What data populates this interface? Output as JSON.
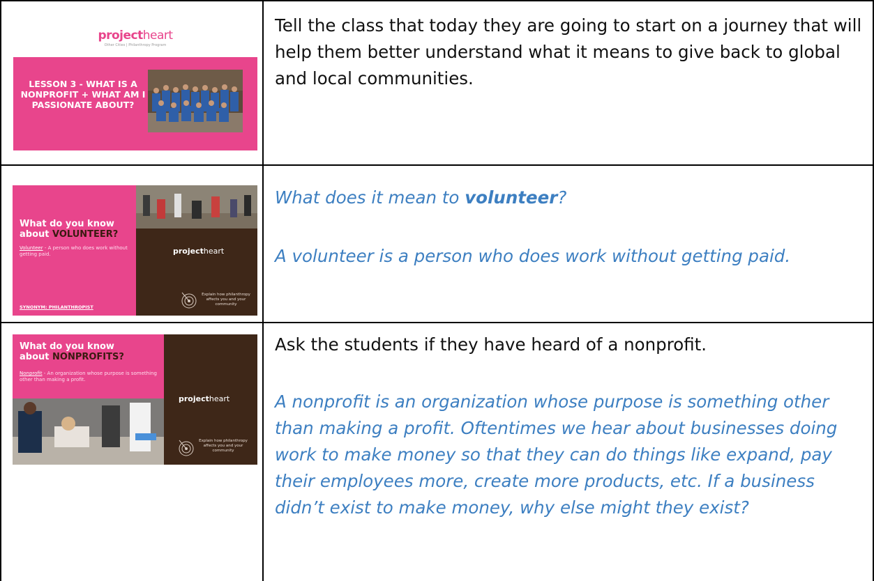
{
  "row1": {
    "slide": {
      "logo_project": "project",
      "logo_heart": "heart",
      "tagline": "Other Cities | Philanthropy Program",
      "title": "LESSON 3 - WHAT IS A NONPROFIT + WHAT AM I PASSIONATE ABOUT?"
    },
    "text": "Tell the class that today they are going to start on a journey that will help them better understand what it means to give back to global and local communities."
  },
  "row2": {
    "slide": {
      "heading_line1": "What do you know",
      "heading_prefix": "about ",
      "heading_highlight": "VOLUNTEER?",
      "term": "Volunteer",
      "definition": " - A person who does work without getting paid.",
      "synonym": "SYNONYM: PHILANTHROPIST",
      "logo_project": "project",
      "logo_heart": "heart",
      "footer": "Explain how philanthropy affects you and your community"
    },
    "question_prefix": "What does it mean to ",
    "question_bold": "volunteer",
    "question_suffix": "?",
    "answer": "A volunteer is a person who does work without getting paid."
  },
  "row3": {
    "slide": {
      "heading_line1": "What do you know",
      "heading_prefix": "about ",
      "heading_highlight": "NONPROFITS?",
      "term": "Nonprofit",
      "definition": " - An organization whose purpose is something other than making a profit.",
      "logo_project": "project",
      "logo_heart": "heart",
      "footer": "Explain how philanthropy affects you and your community"
    },
    "prompt": "Ask the students if they have heard of a nonprofit.",
    "answer": "A nonprofit is an organization whose purpose is something other than making a profit. Oftentimes we hear about businesses doing work to make money so that they can do things like expand, pay their employees more, create more products, etc. If a business didn’t exist to make money, why else might they exist?"
  }
}
